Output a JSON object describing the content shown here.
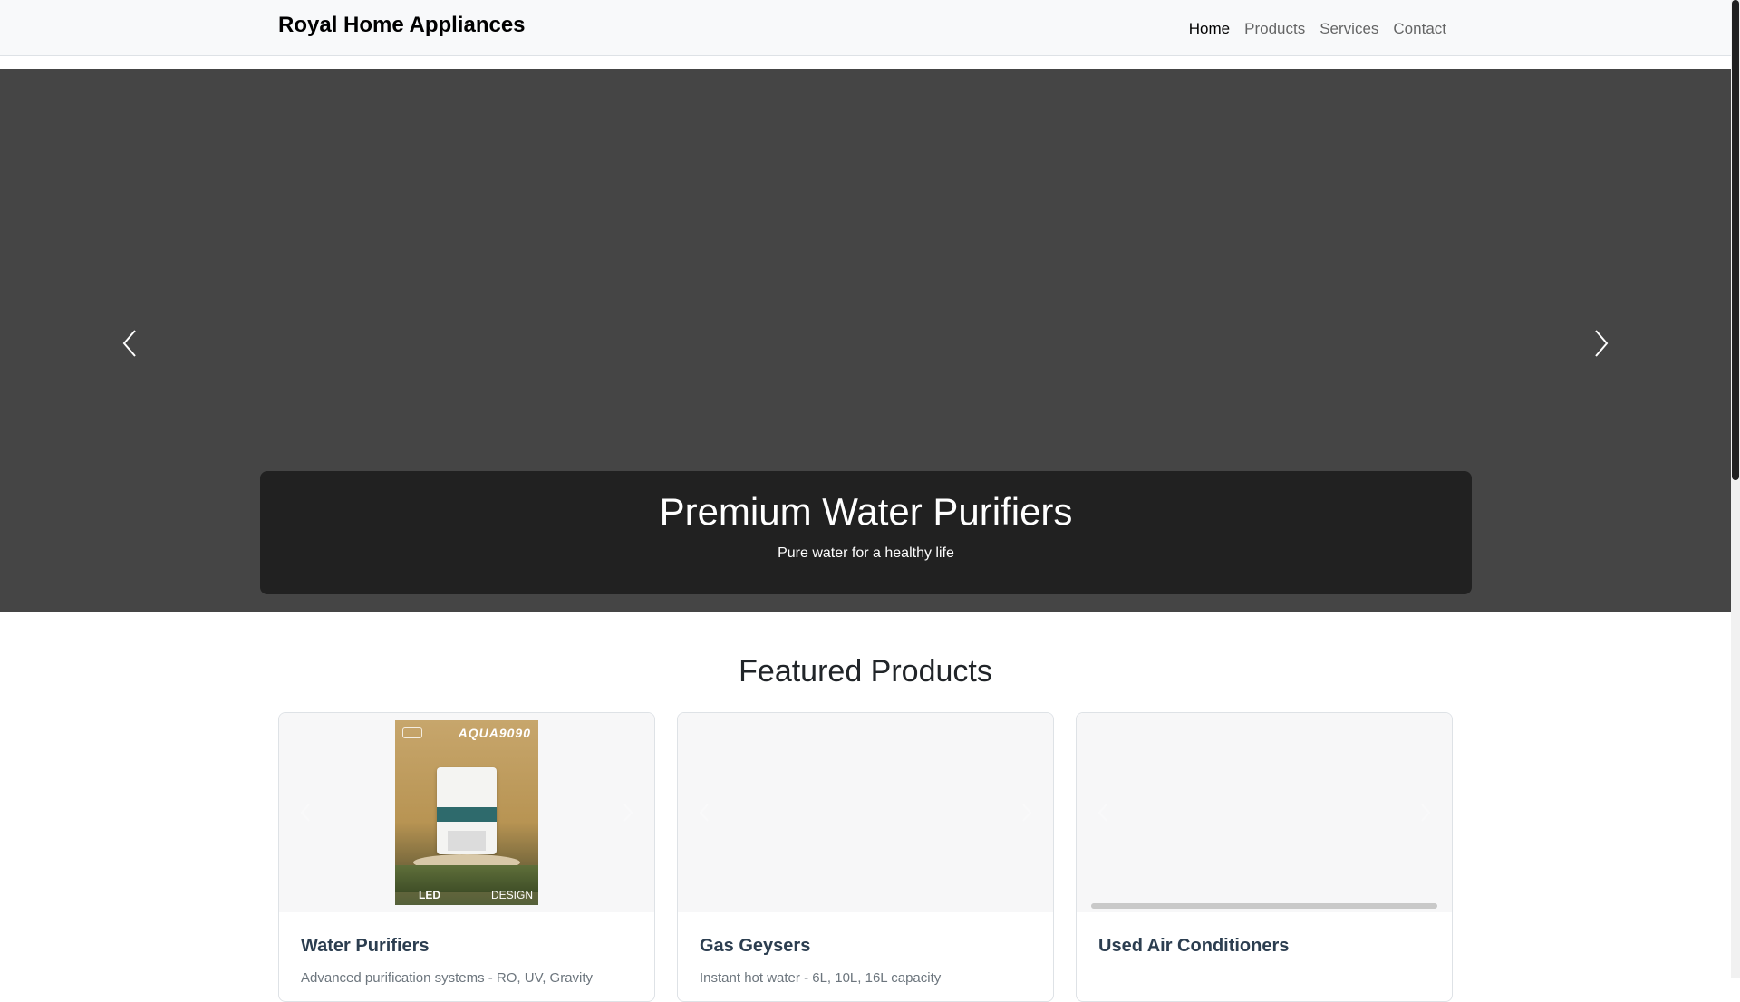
{
  "navbar": {
    "brand": "Royal Home Appliances",
    "links": [
      {
        "label": "Home",
        "active": true
      },
      {
        "label": "Products",
        "active": false
      },
      {
        "label": "Services",
        "active": false
      },
      {
        "label": "Contact",
        "active": false
      }
    ]
  },
  "hero": {
    "caption_title": "Premium Water Purifiers",
    "caption_subtitle": "Pure water for a healthy life",
    "prev_icon": "chevron-left-icon",
    "next_icon": "chevron-right-icon"
  },
  "featured": {
    "title": "Featured Products",
    "cards": [
      {
        "title": "Water Purifiers",
        "description": "Advanced purification systems - RO, UV, Gravity",
        "image_text": {
          "brand_word": "AQUA9090",
          "badge_left": "LED",
          "badge_right": "DESIGN"
        }
      },
      {
        "title": "Gas Geysers",
        "description": "Instant hot water - 6L, 10L, 16L capacity"
      },
      {
        "title": "Used Air Conditioners",
        "description": "",
        "progress": 1.0
      }
    ]
  },
  "colors": {
    "navbar_bg": "#f8f9fa",
    "hero_bg": "#454545",
    "caption_bg": "#212121",
    "card_title": "#2c3e50"
  }
}
